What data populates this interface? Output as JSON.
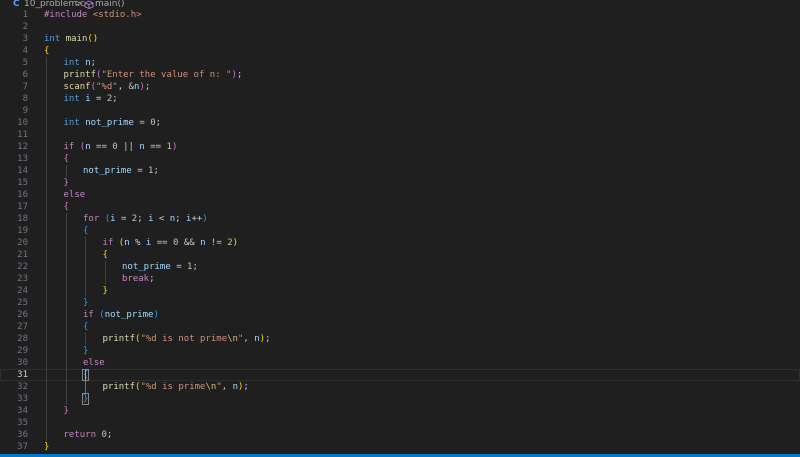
{
  "breadcrumb": {
    "language_badge": "C",
    "file": "10_problem.c",
    "separator": ">",
    "symbol_icon": "method-cube-icon",
    "symbol": "main()"
  },
  "editor": {
    "current_line": 31,
    "lines": [
      {
        "n": "1",
        "indent": 0,
        "tokens": [
          [
            "pp",
            "#include "
          ],
          [
            "str",
            "<stdio.h>"
          ]
        ]
      },
      {
        "n": "2",
        "indent": 0,
        "tokens": []
      },
      {
        "n": "3",
        "indent": 0,
        "tokens": [
          [
            "kw",
            "int"
          ],
          [
            "pun",
            " "
          ],
          [
            "fn",
            "main"
          ],
          [
            "b1",
            "()"
          ]
        ]
      },
      {
        "n": "4",
        "indent": 0,
        "tokens": [
          [
            "b1",
            "{"
          ]
        ]
      },
      {
        "n": "5",
        "indent": 1,
        "tokens": [
          [
            "kw",
            "int"
          ],
          [
            "pun",
            " "
          ],
          [
            "var",
            "n"
          ],
          [
            "pun",
            ";"
          ]
        ]
      },
      {
        "n": "6",
        "indent": 1,
        "tokens": [
          [
            "fn",
            "printf"
          ],
          [
            "b2",
            "("
          ],
          [
            "str",
            "\"Enter the value of n: \""
          ],
          [
            "b2",
            ")"
          ],
          [
            "pun",
            ";"
          ]
        ]
      },
      {
        "n": "7",
        "indent": 1,
        "tokens": [
          [
            "fn",
            "scanf"
          ],
          [
            "b2",
            "("
          ],
          [
            "str",
            "\"%d\""
          ],
          [
            "pun",
            ", "
          ],
          [
            "op",
            "&"
          ],
          [
            "var",
            "n"
          ],
          [
            "b2",
            ")"
          ],
          [
            "pun",
            ";"
          ]
        ]
      },
      {
        "n": "8",
        "indent": 1,
        "tokens": [
          [
            "kw",
            "int"
          ],
          [
            "pun",
            " "
          ],
          [
            "var",
            "i"
          ],
          [
            "op",
            " = "
          ],
          [
            "num",
            "2"
          ],
          [
            "pun",
            ";"
          ]
        ]
      },
      {
        "n": "9",
        "indent": 1,
        "tokens": []
      },
      {
        "n": "10",
        "indent": 1,
        "tokens": [
          [
            "kw",
            "int"
          ],
          [
            "pun",
            " "
          ],
          [
            "var",
            "not_prime"
          ],
          [
            "op",
            " = "
          ],
          [
            "num",
            "0"
          ],
          [
            "pun",
            ";"
          ]
        ]
      },
      {
        "n": "11",
        "indent": 1,
        "tokens": []
      },
      {
        "n": "12",
        "indent": 1,
        "tokens": [
          [
            "ctl",
            "if"
          ],
          [
            "pun",
            " "
          ],
          [
            "b2",
            "("
          ],
          [
            "var",
            "n"
          ],
          [
            "op",
            " == "
          ],
          [
            "num",
            "0"
          ],
          [
            "op",
            " || "
          ],
          [
            "var",
            "n"
          ],
          [
            "op",
            " == "
          ],
          [
            "num",
            "1"
          ],
          [
            "b2",
            ")"
          ]
        ]
      },
      {
        "n": "13",
        "indent": 1,
        "tokens": [
          [
            "b2",
            "{"
          ]
        ]
      },
      {
        "n": "14",
        "indent": 2,
        "tokens": [
          [
            "var",
            "not_prime"
          ],
          [
            "op",
            " = "
          ],
          [
            "num",
            "1"
          ],
          [
            "pun",
            ";"
          ]
        ]
      },
      {
        "n": "15",
        "indent": 1,
        "tokens": [
          [
            "b2",
            "}"
          ]
        ]
      },
      {
        "n": "16",
        "indent": 1,
        "tokens": [
          [
            "ctl",
            "else"
          ]
        ]
      },
      {
        "n": "17",
        "indent": 1,
        "tokens": [
          [
            "b2",
            "{"
          ]
        ]
      },
      {
        "n": "18",
        "indent": 2,
        "tokens": [
          [
            "ctl",
            "for"
          ],
          [
            "pun",
            " "
          ],
          [
            "b3",
            "("
          ],
          [
            "var",
            "i"
          ],
          [
            "op",
            " = "
          ],
          [
            "num",
            "2"
          ],
          [
            "pun",
            "; "
          ],
          [
            "var",
            "i"
          ],
          [
            "op",
            " < "
          ],
          [
            "var",
            "n"
          ],
          [
            "pun",
            "; "
          ],
          [
            "var",
            "i"
          ],
          [
            "op",
            "++"
          ],
          [
            "b3",
            ")"
          ]
        ]
      },
      {
        "n": "19",
        "indent": 2,
        "tokens": [
          [
            "b3",
            "{"
          ]
        ]
      },
      {
        "n": "20",
        "indent": 3,
        "tokens": [
          [
            "ctl",
            "if"
          ],
          [
            "pun",
            " "
          ],
          [
            "b1",
            "("
          ],
          [
            "var",
            "n"
          ],
          [
            "op",
            " % "
          ],
          [
            "var",
            "i"
          ],
          [
            "op",
            " == "
          ],
          [
            "num",
            "0"
          ],
          [
            "op",
            " && "
          ],
          [
            "var",
            "n"
          ],
          [
            "op",
            " != "
          ],
          [
            "num",
            "2"
          ],
          [
            "b1",
            ")"
          ]
        ]
      },
      {
        "n": "21",
        "indent": 3,
        "tokens": [
          [
            "b1",
            "{"
          ]
        ]
      },
      {
        "n": "22",
        "indent": 4,
        "tokens": [
          [
            "var",
            "not_prime"
          ],
          [
            "op",
            " = "
          ],
          [
            "num",
            "1"
          ],
          [
            "pun",
            ";"
          ]
        ]
      },
      {
        "n": "23",
        "indent": 4,
        "tokens": [
          [
            "ctl",
            "break"
          ],
          [
            "pun",
            ";"
          ]
        ]
      },
      {
        "n": "24",
        "indent": 3,
        "tokens": [
          [
            "b1",
            "}"
          ]
        ]
      },
      {
        "n": "25",
        "indent": 2,
        "tokens": [
          [
            "b3",
            "}"
          ]
        ]
      },
      {
        "n": "26",
        "indent": 2,
        "tokens": [
          [
            "ctl",
            "if"
          ],
          [
            "pun",
            " "
          ],
          [
            "b3",
            "("
          ],
          [
            "var",
            "not_prime"
          ],
          [
            "b3",
            ")"
          ]
        ]
      },
      {
        "n": "27",
        "indent": 2,
        "tokens": [
          [
            "b3",
            "{"
          ]
        ]
      },
      {
        "n": "28",
        "indent": 3,
        "tokens": [
          [
            "fn",
            "printf"
          ],
          [
            "b1",
            "("
          ],
          [
            "str",
            "\"%d is not prime"
          ],
          [
            "esc",
            "\\n"
          ],
          [
            "str",
            "\""
          ],
          [
            "pun",
            ", "
          ],
          [
            "var",
            "n"
          ],
          [
            "b1",
            ")"
          ],
          [
            "pun",
            ";"
          ]
        ]
      },
      {
        "n": "29",
        "indent": 2,
        "tokens": [
          [
            "b3",
            "}"
          ]
        ]
      },
      {
        "n": "30",
        "indent": 2,
        "tokens": [
          [
            "ctl",
            "else"
          ]
        ]
      },
      {
        "n": "31",
        "indent": 2,
        "tokens": [
          [
            "b3m",
            "{"
          ]
        ]
      },
      {
        "n": "32",
        "indent": 3,
        "tokens": [
          [
            "fn",
            "printf"
          ],
          [
            "b1",
            "("
          ],
          [
            "str",
            "\"%d is prime"
          ],
          [
            "esc",
            "\\n"
          ],
          [
            "str",
            "\""
          ],
          [
            "pun",
            ", "
          ],
          [
            "var",
            "n"
          ],
          [
            "b1",
            ")"
          ],
          [
            "pun",
            ";"
          ]
        ]
      },
      {
        "n": "33",
        "indent": 2,
        "tokens": [
          [
            "b3m",
            "}"
          ]
        ]
      },
      {
        "n": "34",
        "indent": 1,
        "tokens": [
          [
            "b2",
            "}"
          ]
        ]
      },
      {
        "n": "35",
        "indent": 1,
        "tokens": []
      },
      {
        "n": "36",
        "indent": 1,
        "tokens": [
          [
            "ctl",
            "return"
          ],
          [
            "pun",
            " "
          ],
          [
            "num",
            "0"
          ],
          [
            "pun",
            ";"
          ]
        ]
      },
      {
        "n": "37",
        "indent": 0,
        "tokens": [
          [
            "b1",
            "}"
          ]
        ]
      }
    ]
  },
  "colors": {
    "background": "#1f1f1f",
    "keyword": "#569cd6",
    "control": "#c586c0",
    "function": "#dcdcaa",
    "variable": "#9cdcfe",
    "number": "#b5cea8",
    "string": "#ce9178",
    "status_bar": "#007acc"
  }
}
